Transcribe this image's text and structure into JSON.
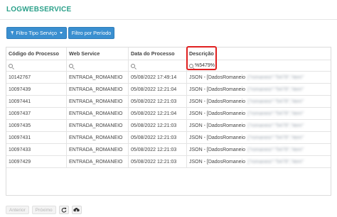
{
  "page": {
    "title": "LOGWEBSERVICE"
  },
  "toolbar": {
    "filter_type_label": "Filtro Tipo Serviço",
    "filter_period_label": "Filtro por Período",
    "accent_color": "#3a8fd0"
  },
  "table": {
    "columns": [
      "Código do Processo",
      "Web Service",
      "Data do Processo",
      "Descrição"
    ],
    "filters": [
      "",
      "",
      "",
      "%5479%"
    ],
    "rows": [
      {
        "code": "10142767",
        "service": "ENTRADA_ROMANEIO",
        "date": "05/08/2022 17:49:14",
        "desc": "JSON - [DadosRomaneio",
        "desc_hidden": "{\"romaneio\":\"5479\",\"item\""
      },
      {
        "code": "10097439",
        "service": "ENTRADA_ROMANEIO",
        "date": "05/08/2022 12:21:04",
        "desc": "JSON - [DadosRomaneio",
        "desc_hidden": "{\"romaneio\":\"5479\",\"item\""
      },
      {
        "code": "10097441",
        "service": "ENTRADA_ROMANEIO",
        "date": "05/08/2022 12:21:03",
        "desc": "JSON - [DadosRomaneio",
        "desc_hidden": "{\"romaneio\":\"5479\",\"item\""
      },
      {
        "code": "10097437",
        "service": "ENTRADA_ROMANEIO",
        "date": "05/08/2022 12:21:04",
        "desc": "JSON - [DadosRomaneio",
        "desc_hidden": "{\"romaneio\":\"5479\",\"item\""
      },
      {
        "code": "10097435",
        "service": "ENTRADA_ROMANEIO",
        "date": "05/08/2022 12:21:03",
        "desc": "JSON - [DadosRomaneio",
        "desc_hidden": "{\"romaneio\":\"5479\",\"item\""
      },
      {
        "code": "10097431",
        "service": "ENTRADA_ROMANEIO",
        "date": "05/08/2022 12:21:03",
        "desc": "JSON - [DadosRomaneio",
        "desc_hidden": "{\"romaneio\":\"5479\",\"item\""
      },
      {
        "code": "10097433",
        "service": "ENTRADA_ROMANEIO",
        "date": "05/08/2022 12:21:03",
        "desc": "JSON - [DadosRomaneio",
        "desc_hidden": "{\"romaneio\":\"5479\",\"item\""
      },
      {
        "code": "10097429",
        "service": "ENTRADA_ROMANEIO",
        "date": "05/08/2022 12:21:03",
        "desc": "JSON - [DadosRomaneio",
        "desc_hidden": "{\"romaneio\":\"5479\",\"item\""
      }
    ]
  },
  "pager": {
    "prev_label": "Anterior",
    "next_label": "Próximo",
    "refresh_icon": "refresh-icon",
    "download_icon": "cloud-download-icon"
  }
}
